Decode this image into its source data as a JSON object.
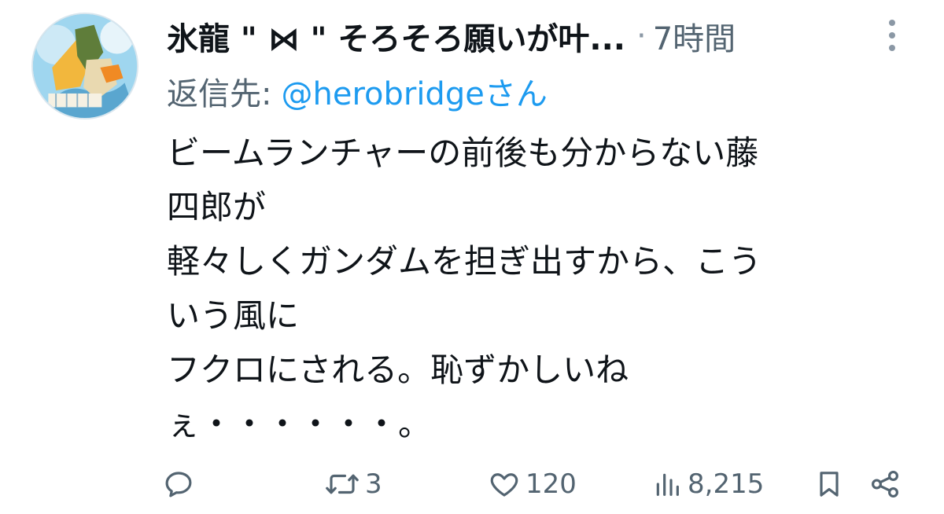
{
  "tweet": {
    "display_name": "氷龍 \" ⋈ \" そろそろ願いが叶...",
    "separator": "·",
    "timestamp": "7時間",
    "reply_prefix": "返信先:",
    "reply_handle": "@herobridgeさん",
    "body_lines": [
      "ビームランチャーの前後も分からない藤",
      "四郎が",
      "軽々しくガンダムを担ぎ出すから、こう",
      "いう風に",
      "フクロにされる。恥ずかしいね",
      "ぇ・・・・・・。"
    ]
  },
  "actions": {
    "reply_count": "",
    "retweet_count": "3",
    "like_count": "120",
    "view_count": "8,215"
  },
  "icons": {
    "reply": "reply-icon",
    "retweet": "retweet-icon",
    "like": "heart-icon",
    "views": "views-icon",
    "bookmark": "bookmark-icon",
    "share": "share-icon",
    "more": "more-vertical-icon"
  },
  "colors": {
    "text": "#0f1419",
    "secondary": "#536471",
    "link": "#1d9bf0"
  }
}
